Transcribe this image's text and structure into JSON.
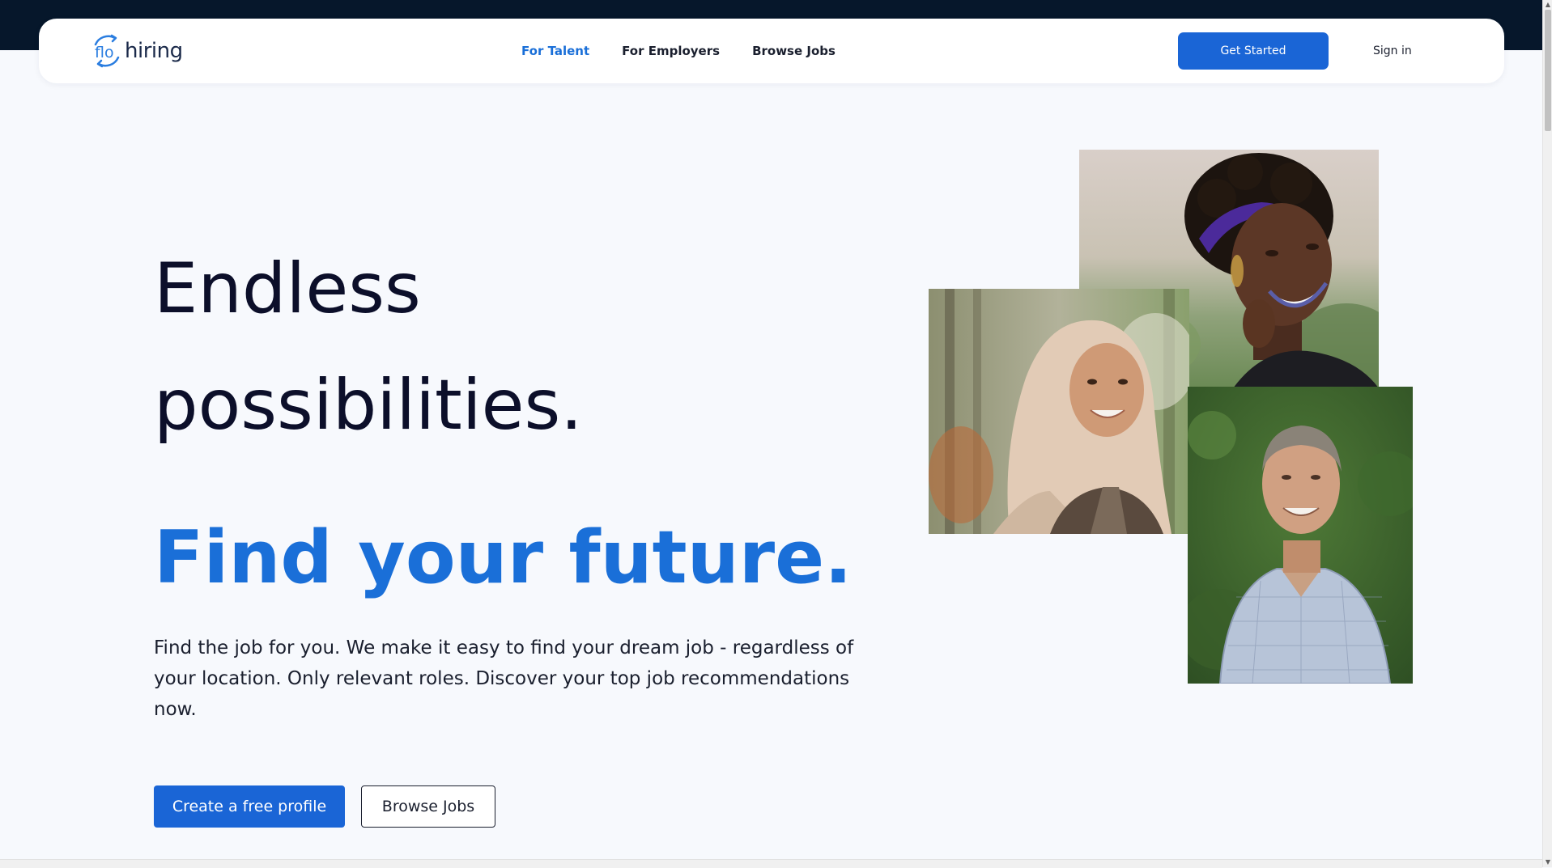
{
  "nav": {
    "logo_mark": "flo",
    "logo_text": "hiring",
    "links": [
      {
        "label": "For Talent",
        "active": true
      },
      {
        "label": "For Employers",
        "active": false
      },
      {
        "label": "Browse Jobs",
        "active": false
      }
    ],
    "get_started_label": "Get Started",
    "sign_in_label": "Sign in"
  },
  "hero": {
    "title_line1": "Endless",
    "title_line2": "possibilities.",
    "accent_line": "Find your future.",
    "description": "Find the job for you. We make it easy to find your dream job - regardless of your location. Only relevant roles. Discover your top job recommendations now.",
    "primary_cta": "Create a free profile",
    "secondary_cta": "Browse Jobs"
  },
  "photos": [
    {
      "icon": "smiling-woman-photo"
    },
    {
      "icon": "woman-hijab-photo"
    },
    {
      "icon": "smiling-man-photo"
    }
  ],
  "colors": {
    "brand_blue": "#1a65d6",
    "accent_text": "#1a6fd8",
    "heading": "#0c0f2a",
    "page_bg": "#f7f9fd",
    "top_bar": "#06172b"
  }
}
